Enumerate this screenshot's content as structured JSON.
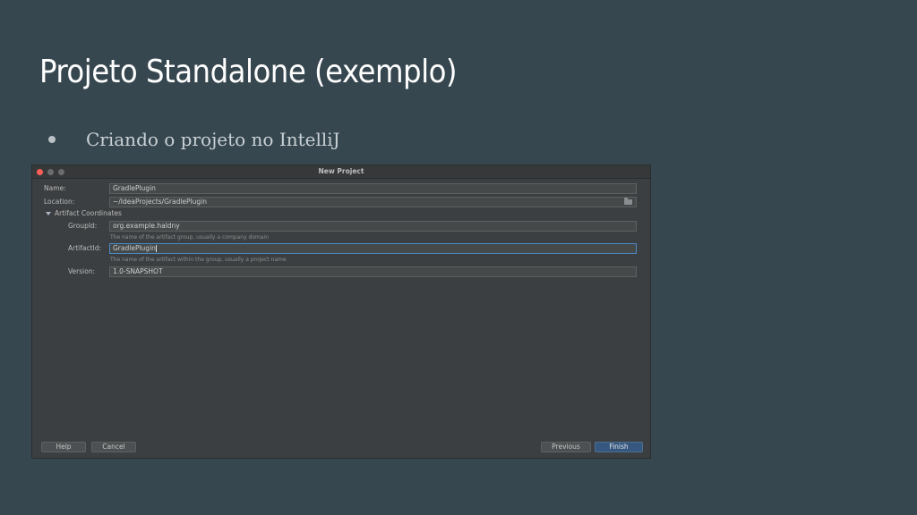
{
  "slide": {
    "title": "Projeto Standalone (exemplo)",
    "bullet": "Criando o projeto no IntelliJ"
  },
  "dialog": {
    "title": "New Project",
    "name_label": "Name:",
    "name_value": "GradlePlugin",
    "location_label": "Location:",
    "location_value": "~/IdeaProjects/GradlePlugin",
    "artifact_section": "Artifact Coordinates",
    "groupid_label": "GroupId:",
    "groupid_value": "org.example.haldny",
    "groupid_hint": "The name of the artifact group, usually a company domain",
    "artifactid_label": "ArtifactId:",
    "artifactid_value": "GradlePlugin",
    "artifactid_hint": "The name of the artifact within the group, usually a project name",
    "version_label": "Version:",
    "version_value": "1.0-SNAPSHOT",
    "buttons": {
      "help": "Help",
      "cancel": "Cancel",
      "previous": "Previous",
      "finish": "Finish"
    }
  }
}
